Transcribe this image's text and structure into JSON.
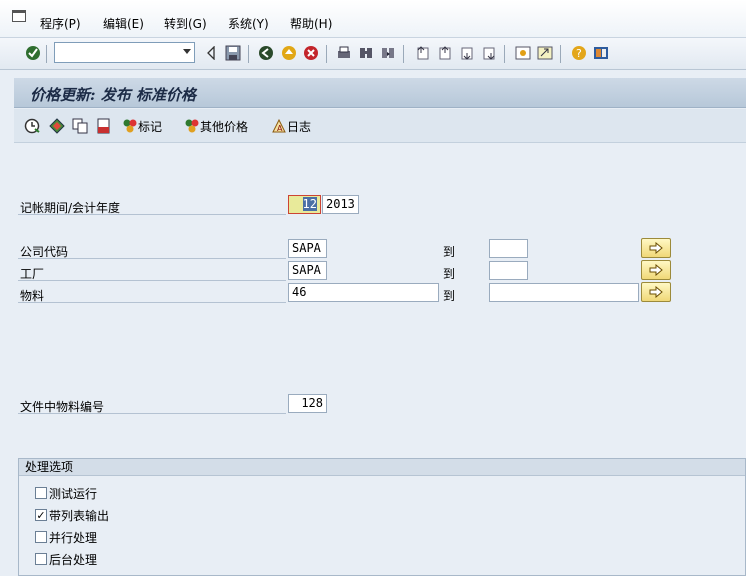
{
  "menu": {
    "items": [
      "程序(P)",
      "编辑(E)",
      "转到(G)",
      "系统(Y)",
      "帮助(H)"
    ]
  },
  "toolbar": {
    "command_value": ""
  },
  "title": "价格更新: 发布 标准价格",
  "app_toolbar": {
    "mark_label": "标记",
    "other_prices_label": "其他价格",
    "log_label": "日志"
  },
  "form": {
    "period_label": "记帐期间/会计年度",
    "period_value": "12",
    "year_value": "2013",
    "company_label": "公司代码",
    "company_value": "SAPA",
    "company_to_label": "到",
    "company_to_value": "",
    "plant_label": "工厂",
    "plant_value": "SAPA",
    "plant_to_label": "到",
    "plant_to_value": "",
    "material_label": "物料",
    "material_value": "46",
    "material_to_label": "到",
    "material_to_value": "",
    "count_label": "文件中物料编号",
    "count_value": "128"
  },
  "options": {
    "heading": "处理选项",
    "items": [
      {
        "label": "测试运行",
        "checked": false
      },
      {
        "label": "带列表输出",
        "checked": true
      },
      {
        "label": "并行处理",
        "checked": false
      },
      {
        "label": "后台处理",
        "checked": false
      }
    ]
  },
  "colors": {
    "background": "#e8eef5",
    "title_bg": "#c4d3e2",
    "focus_field": "#e8ea9a",
    "arrow_button": "#f0d878"
  }
}
